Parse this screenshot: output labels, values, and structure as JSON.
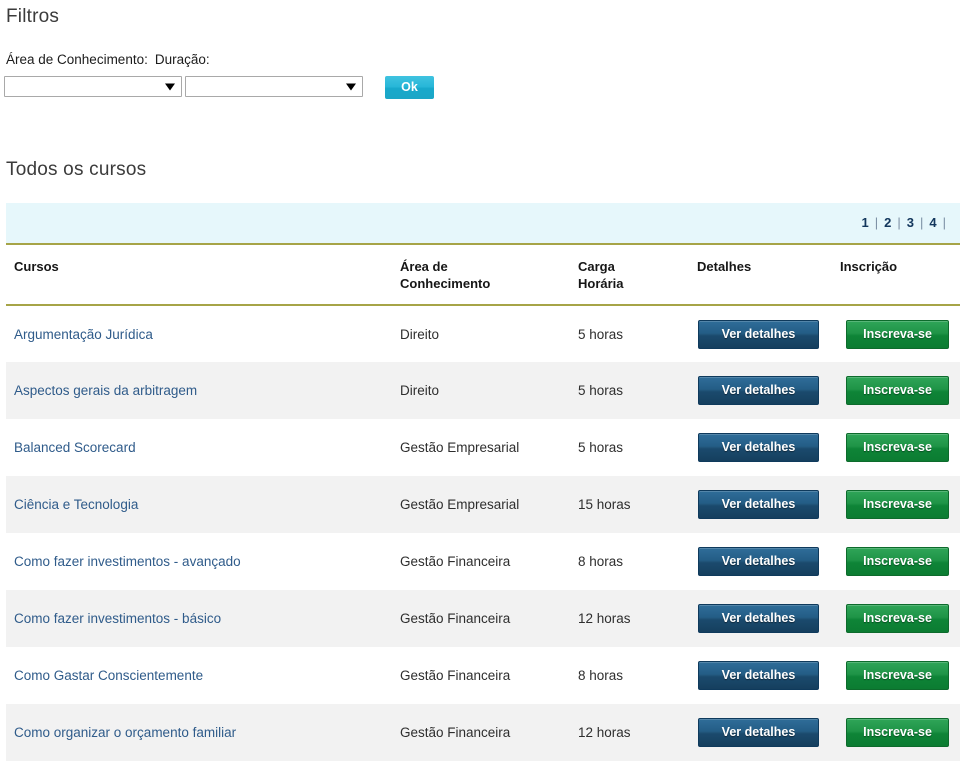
{
  "filters": {
    "heading": "Filtros",
    "area_label": "Área de Conhecimento:",
    "duracao_label": "Duração:",
    "area_select_value": "",
    "duracao_select_value": "",
    "ok_label": "Ok"
  },
  "courses_section": {
    "heading": "Todos os cursos",
    "pagination": {
      "pages": [
        "1",
        "2",
        "3",
        "4"
      ],
      "separator": "|",
      "trailing_separator": "|"
    },
    "columns": {
      "curso": "Cursos",
      "area_line1": "Área de",
      "area_line2": "Conhecimento",
      "carga_line1": "Carga",
      "carga_line2": "Horária",
      "detalhes": "Detalhes",
      "inscricao": "Inscrição"
    },
    "button_labels": {
      "detalhes": "Ver detalhes",
      "inscricao": "Inscreva-se"
    },
    "rows": [
      {
        "curso": "Argumentação Jurídica",
        "area": "Direito",
        "carga": "5 horas"
      },
      {
        "curso": "Aspectos gerais da arbitragem",
        "area": "Direito",
        "carga": "5 horas"
      },
      {
        "curso": "Balanced Scorecard",
        "area": "Gestão Empresarial",
        "carga": "5 horas"
      },
      {
        "curso": "Ciência e Tecnologia",
        "area": "Gestão Empresarial",
        "carga": "15 horas"
      },
      {
        "curso": "Como fazer investimentos - avançado",
        "area": "Gestão Financeira",
        "carga": "8 horas"
      },
      {
        "curso": "Como fazer investimentos - básico",
        "area": "Gestão Financeira",
        "carga": "12 horas"
      },
      {
        "curso": "Como Gastar Conscientemente",
        "area": "Gestão Financeira",
        "carga": "8 horas"
      },
      {
        "curso": "Como organizar o orçamento familiar",
        "area": "Gestão Financeira",
        "carga": "12 horas"
      }
    ]
  },
  "colors": {
    "pager_background": "#e6f7fb",
    "rule": "#a6a447",
    "link": "#2f5b8a",
    "detail_button": "#1b4a6d",
    "enroll_button": "#0e8437",
    "ok_button": "#18a9cc",
    "row_alt": "#f2f2f2"
  }
}
